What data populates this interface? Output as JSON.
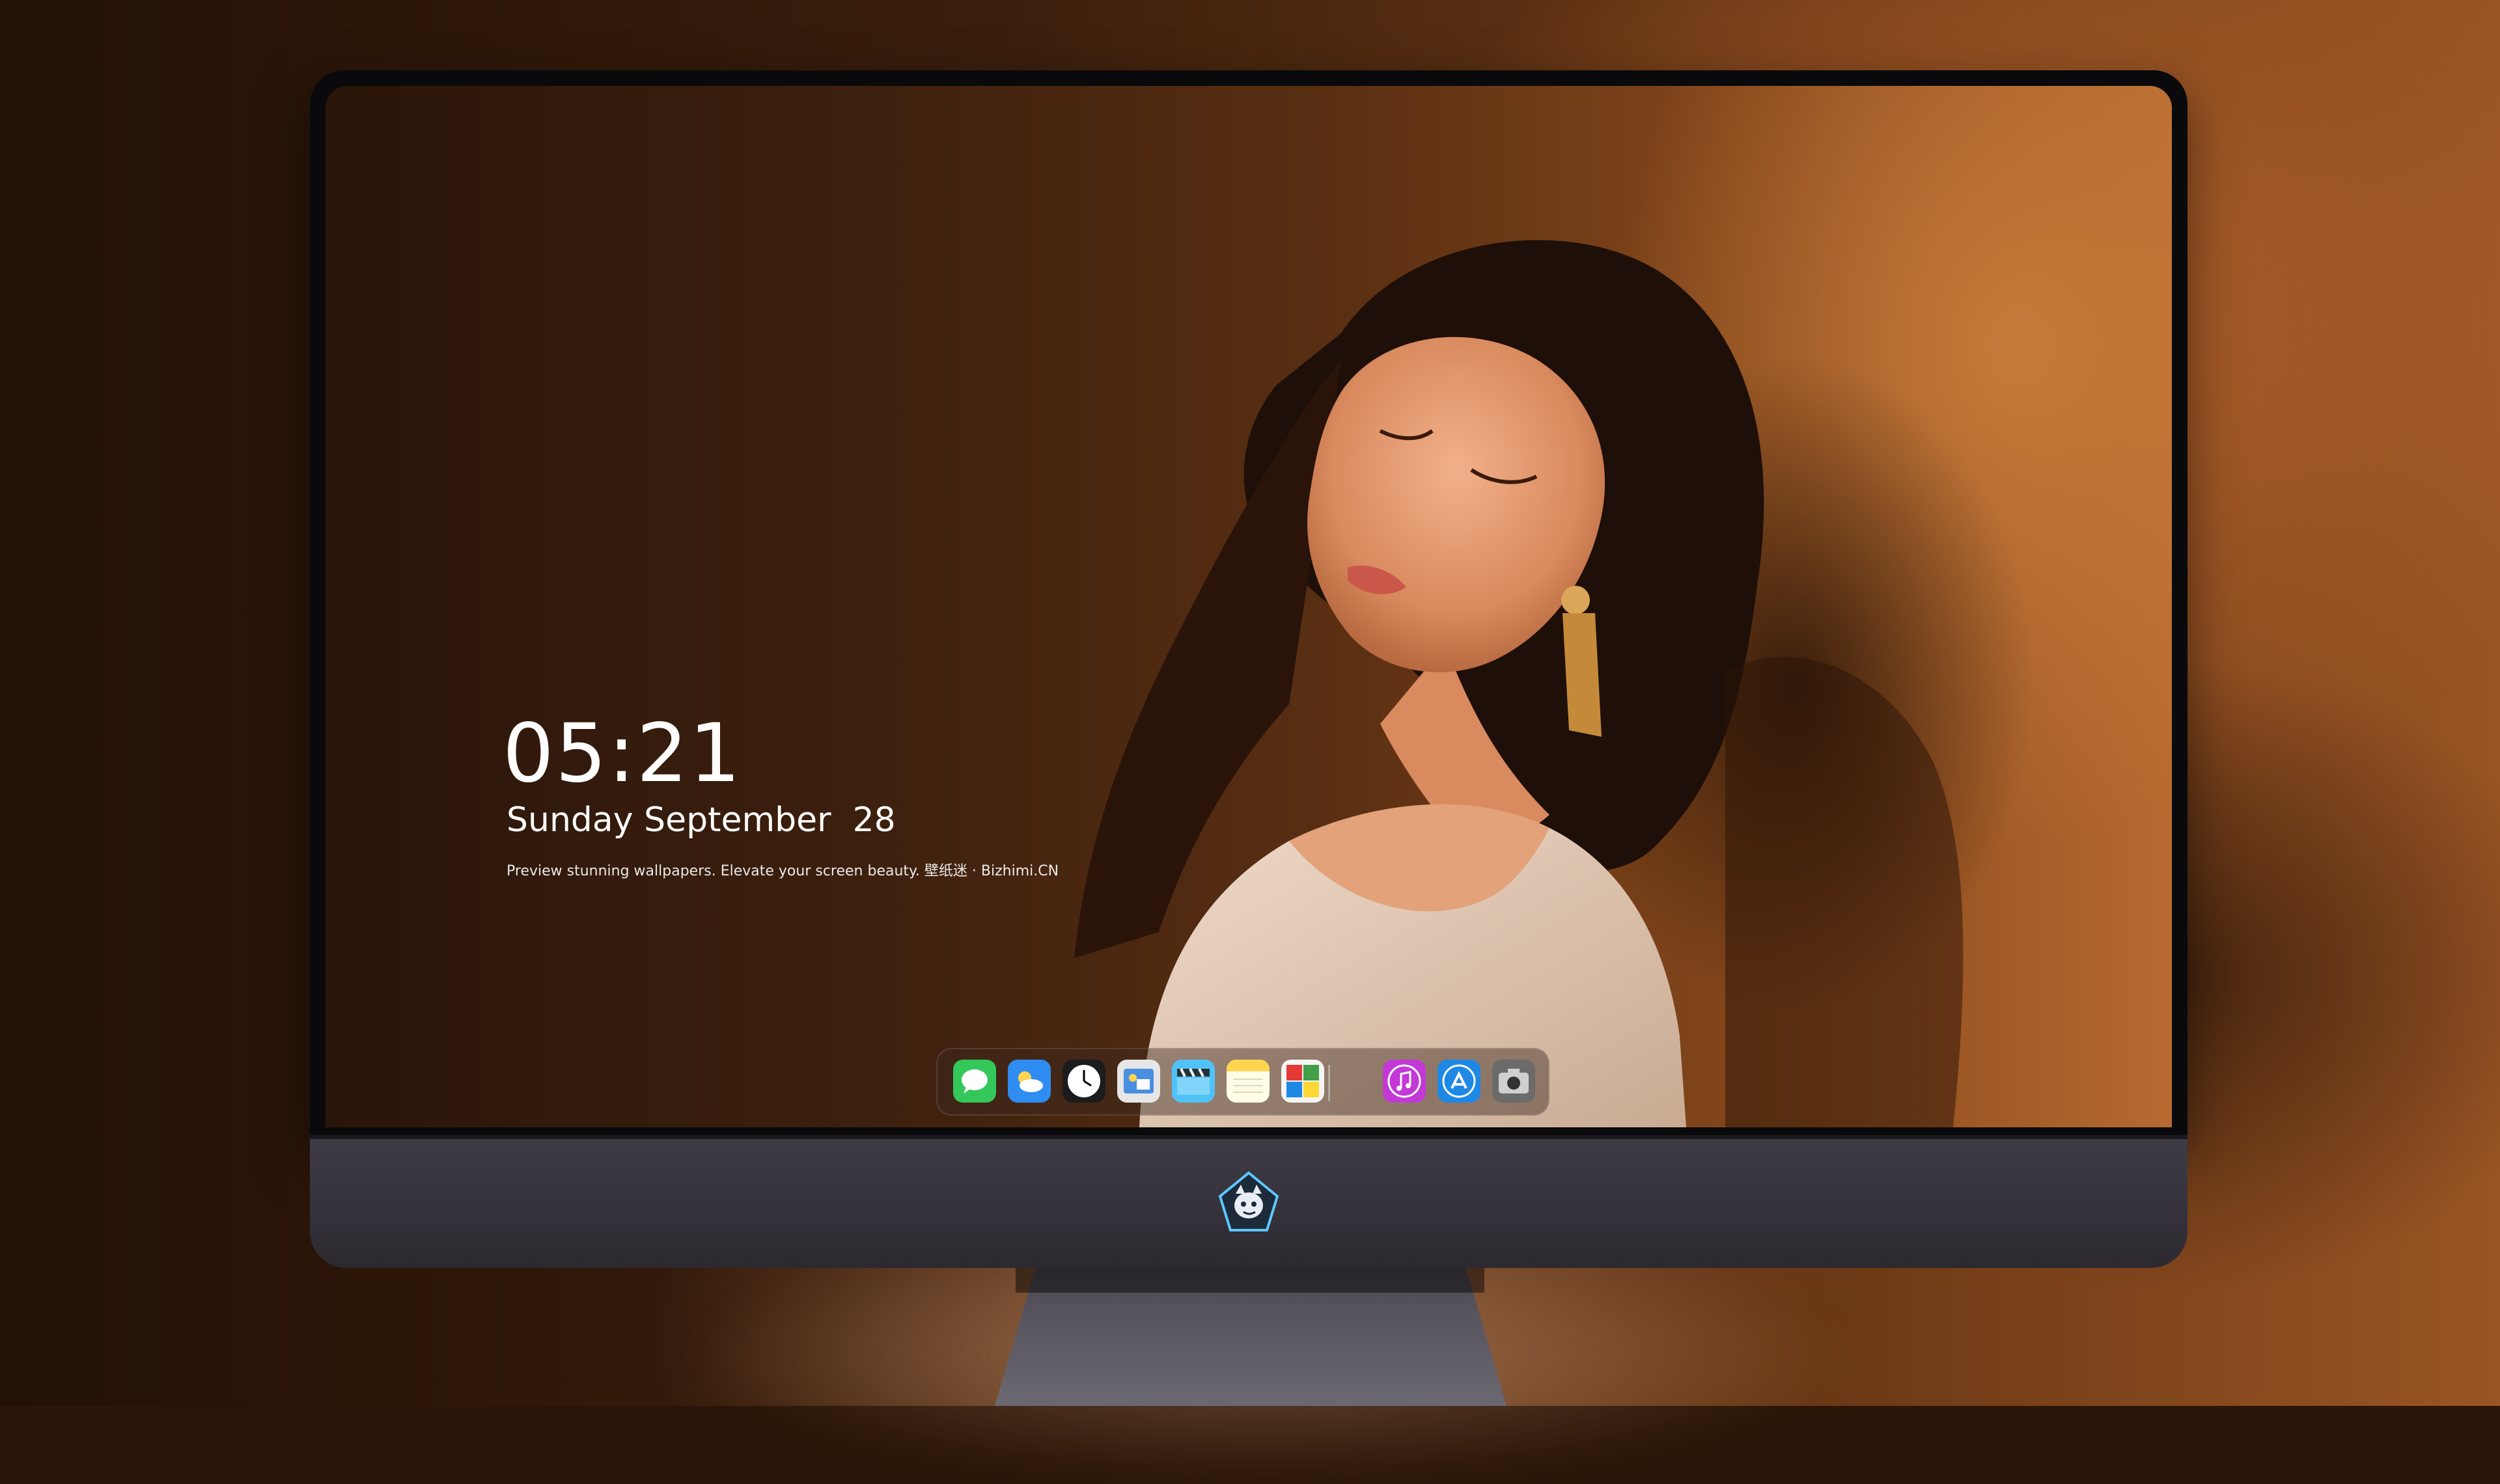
{
  "lock_screen": {
    "time": "05:21",
    "date": "Sunday September  28",
    "tagline": "Preview stunning wallpapers. Elevate your screen beauty. 壁纸迷 · Bizhimi.CN"
  },
  "dock": {
    "apps": [
      {
        "name": "messages-icon",
        "color": "#34c759"
      },
      {
        "name": "weather-icon",
        "color": "#2f8cf0"
      },
      {
        "name": "clock-icon",
        "color": "#1c1c1e"
      },
      {
        "name": "preview-icon",
        "color": "#4a90e2"
      },
      {
        "name": "clips-icon",
        "color": "#4fc3f7"
      },
      {
        "name": "notes-icon",
        "color": "#ffd54f"
      },
      {
        "name": "photo-booth-icon",
        "color": "#e53935"
      },
      {
        "name": "music-icon",
        "color": "#c239d6"
      },
      {
        "name": "app-store-icon",
        "color": "#1e88e5"
      },
      {
        "name": "screenshot-icon",
        "color": "#6b6b6b"
      }
    ]
  },
  "device": {
    "logo": "dragon-mascot-logo"
  }
}
